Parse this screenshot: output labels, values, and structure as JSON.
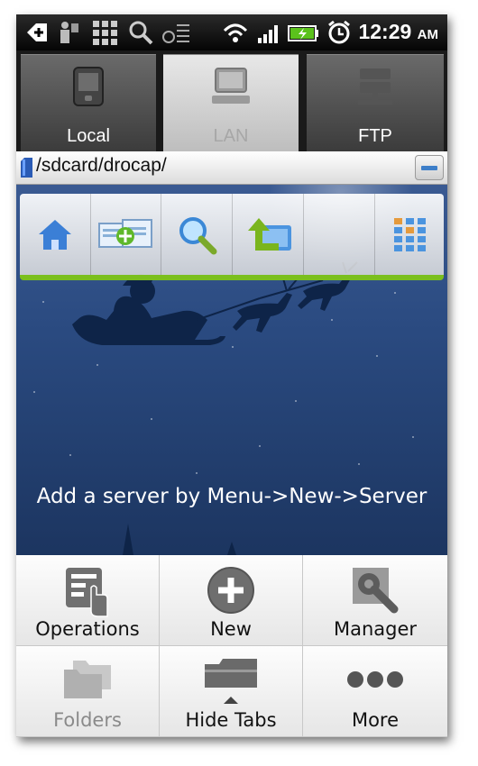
{
  "status_bar": {
    "time": "12:29",
    "ampm": "AM",
    "icons": [
      "back-notification-icon",
      "person-icon",
      "grid-app-icon",
      "search-app-icon",
      "usb-icon",
      "wifi-icon",
      "signal-icon",
      "battery-charging-icon",
      "alarm-icon"
    ]
  },
  "tabs": [
    {
      "label": "Local",
      "icon": "phone-icon",
      "active": false
    },
    {
      "label": "LAN",
      "icon": "computer-icon",
      "active": true
    },
    {
      "label": "FTP",
      "icon": "server-icon",
      "active": false
    }
  ],
  "path_bar": {
    "path": "/sdcard/drocap/",
    "icon": "sdcard-icon"
  },
  "toolbar": {
    "buttons": [
      "home-icon",
      "new-window-icon",
      "search-icon",
      "up-folder-icon",
      "empty",
      "grid-view-icon"
    ],
    "accent": "#7bbf1d"
  },
  "hint": "Add a server by Menu->New->Server",
  "menu": {
    "items": [
      {
        "label": "Operations",
        "icon": "operations-icon",
        "enabled": true
      },
      {
        "label": "New",
        "icon": "plus-circle-icon",
        "enabled": true
      },
      {
        "label": "Manager",
        "icon": "wrench-icon",
        "enabled": true
      },
      {
        "label": "Folders",
        "icon": "folders-icon",
        "enabled": false
      },
      {
        "label": "Hide Tabs",
        "icon": "hide-tabs-icon",
        "enabled": true
      },
      {
        "label": "More",
        "icon": "more-dots-icon",
        "enabled": true
      }
    ]
  }
}
